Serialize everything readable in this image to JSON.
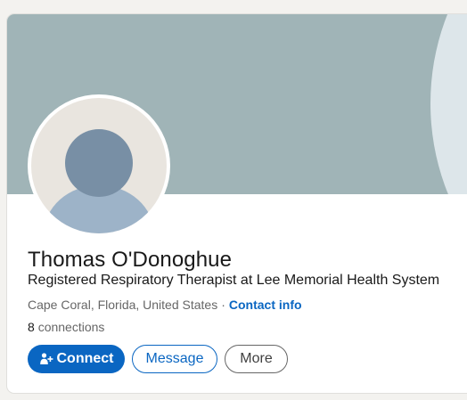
{
  "profile": {
    "name": "Thomas O'Donoghue",
    "headline": "Registered Respiratory Therapist at Lee Memorial Health System",
    "location": "Cape Coral, Florida, United States",
    "separator": "·",
    "contact_info_label": "Contact info",
    "connections_count": "8",
    "connections_label": "connections"
  },
  "actions": {
    "connect_label": "Connect",
    "message_label": "Message",
    "more_label": "More"
  },
  "icons": {
    "connect_icon": "add-person-icon",
    "avatar": "default-avatar-icon"
  },
  "colors": {
    "accent": "#0a66c2",
    "banner": "#a0b4b7",
    "banner_arc": "#dde6ea"
  }
}
